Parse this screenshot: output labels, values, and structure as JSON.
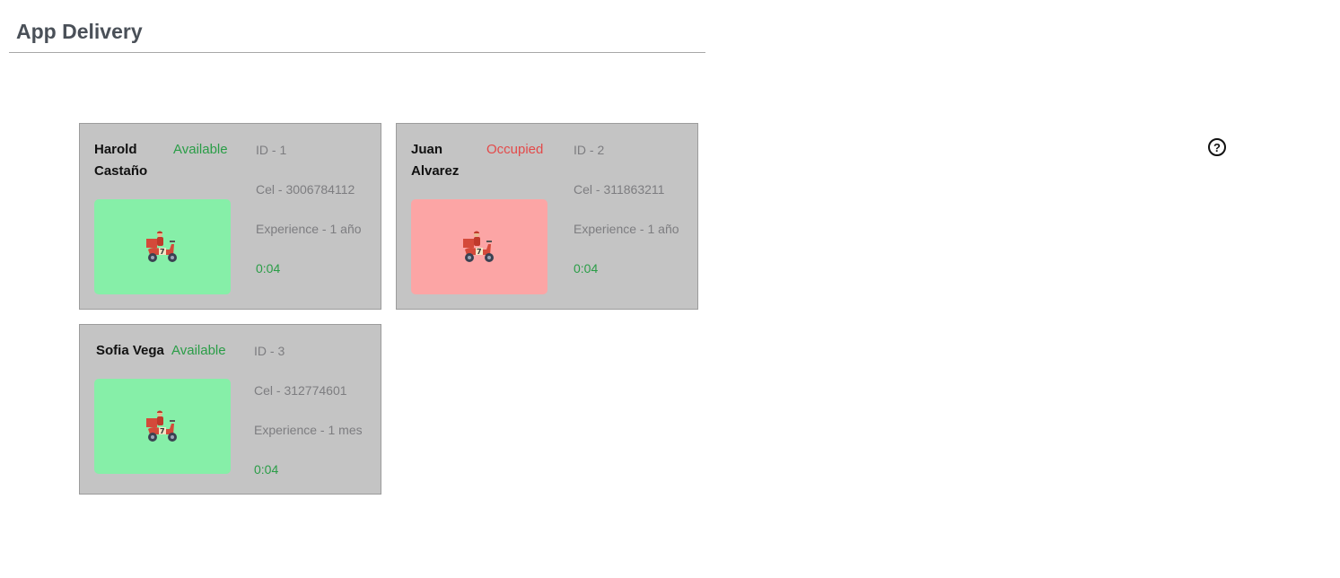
{
  "app": {
    "title": "App Delivery"
  },
  "icons": {
    "help": "?",
    "help_name": "help-circle-icon",
    "courier_name": "delivery-scooter-icon"
  },
  "colors": {
    "available": "#2a9d47",
    "occupied": "#e34a4a",
    "tile_available": "#86efa8",
    "tile_occupied": "#fca5a5",
    "card_bg": "#c4c4c4"
  },
  "couriers": [
    {
      "name_line1": "Harold",
      "name_line2": "Castaño",
      "status": "Available",
      "id": "ID - 1",
      "cel": "Cel - 3006784112",
      "experience": "Experience - 1 año",
      "timer": "0:04"
    },
    {
      "name_line1": "Juan",
      "name_line2": "Alvarez",
      "status": "Occupied",
      "id": "ID - 2",
      "cel": "Cel - 311863211",
      "experience": "Experience - 1 año",
      "timer": "0:04"
    },
    {
      "name_line1": "Sofia Vega",
      "name_line2": "",
      "status": "Available",
      "id": "ID - 3",
      "cel": "Cel - 312774601",
      "experience": "Experience - 1 mes",
      "timer": "0:04"
    }
  ]
}
